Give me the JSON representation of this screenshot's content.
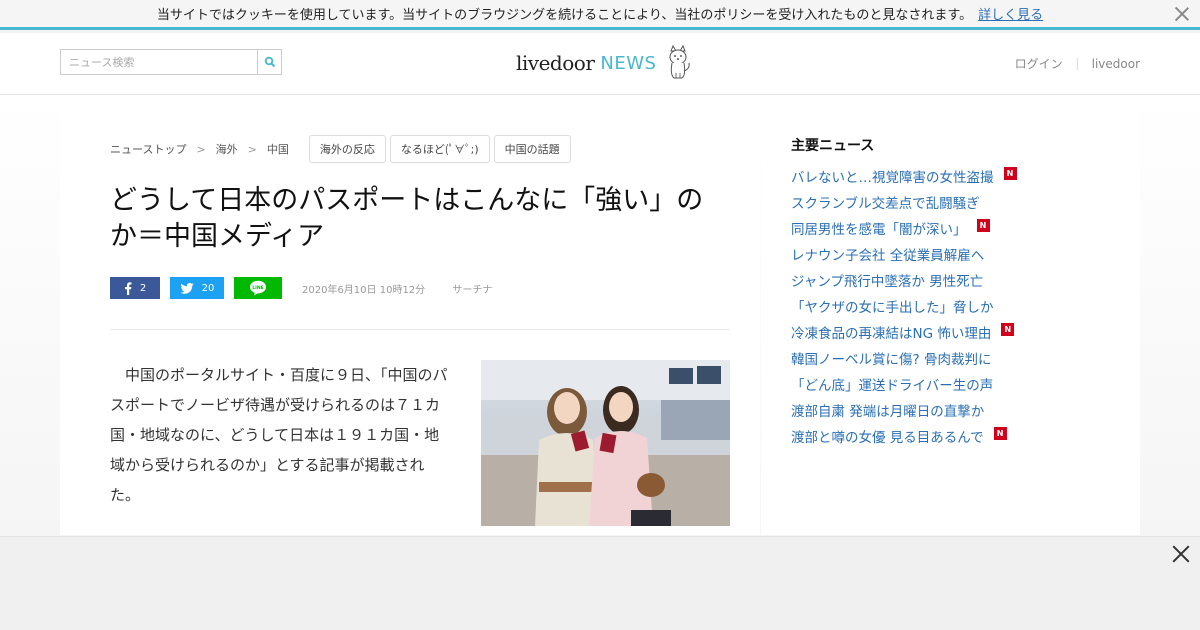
{
  "cookie": {
    "message": "当サイトではクッキーを使用しています。当サイトのブラウジングを続けることにより、当社のポリシーを受け入れたものと見なされます。",
    "link": "詳しく見る"
  },
  "header": {
    "search_placeholder": "ニュース検索",
    "logo_main": "livedoor",
    "logo_news": "NEWS",
    "login": "ログイン",
    "livedoor": "livedoor"
  },
  "breadcrumb": [
    "ニューストップ",
    "海外",
    "中国"
  ],
  "tags": [
    "海外の反応",
    "なるほど(ﾟ∀ﾟ;)",
    "中国の話題"
  ],
  "article": {
    "title": "どうして日本のパスポートはこんなに「強い」のか＝中国メディア",
    "facebook_count": "2",
    "twitter_count": "20",
    "date": "2020年6月10日 10時12分",
    "source": "サーチナ",
    "body": "中国のポータルサイト・百度に９日、「中国のパスポートでノービザ待遇が受けられるのは７１カ国・地域なのに、どうして日本は１９１カ国・地域から受けられるのか」とする記事が掲載された。"
  },
  "sidebar": {
    "title": "主要ニュース",
    "items": [
      {
        "text": "バレないと…視覚障害の女性盗撮",
        "new": true
      },
      {
        "text": "スクランブル交差点で乱闘騒ぎ",
        "new": false
      },
      {
        "text": "同居男性を感電「闇が深い」",
        "new": true
      },
      {
        "text": "レナウン子会社 全従業員解雇へ",
        "new": false
      },
      {
        "text": "ジャンプ飛行中墜落か 男性死亡",
        "new": false
      },
      {
        "text": "「ヤクザの女に手出した」脅しか",
        "new": false
      },
      {
        "text": "冷凍食品の再凍結はNG 怖い理由",
        "new": true
      },
      {
        "text": "韓国ノーベル賞に傷? 骨肉裁判に",
        "new": false
      },
      {
        "text": "「どん底」運送ドライバー生の声",
        "new": false
      },
      {
        "text": "渡部自粛 発端は月曜日の直撃か",
        "new": false
      },
      {
        "text": "渡部と噂の女優 見る目あるんで",
        "new": true
      }
    ],
    "badge": "N"
  },
  "colors": {
    "accent": "#47b8cf",
    "link": "#2a6fb5",
    "facebook": "#3b5998",
    "twitter": "#1da1f2",
    "line": "#00b900",
    "new_badge": "#d0021b"
  }
}
